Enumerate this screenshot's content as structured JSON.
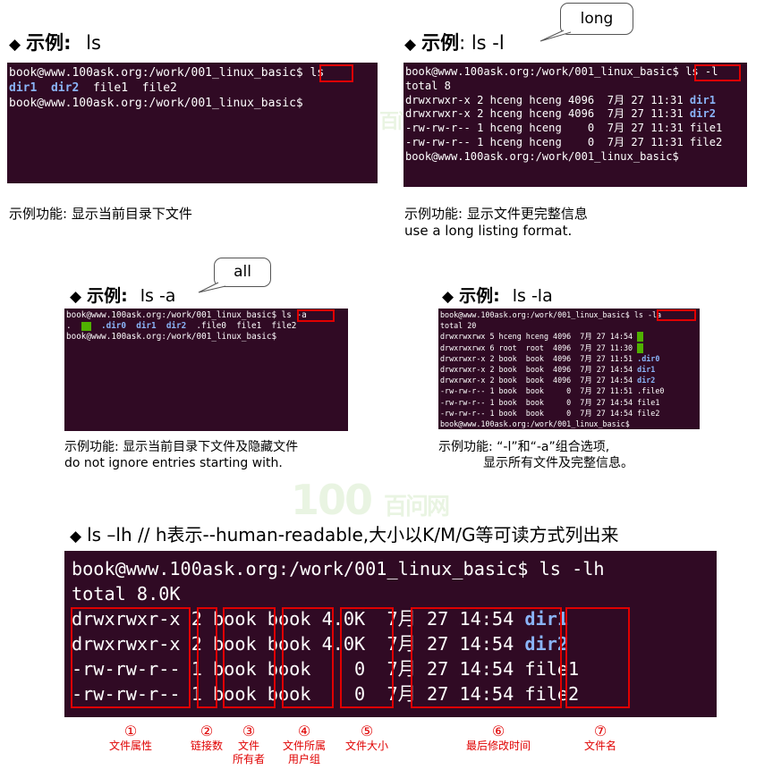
{
  "watermark": {
    "logo": "100",
    "brand": "百问网"
  },
  "ex1": {
    "diamond": "◆",
    "label": "示例:",
    "command": "ls",
    "lines": [
      "book@www.100ask.org:/work/001_linux_basic$ ls",
      "book@www.100ask.org:/work/001_linux_basic$"
    ],
    "ls_items": [
      "dir1",
      "dir2",
      "file1",
      "file2"
    ],
    "caption": "示例功能: 显示当前目录下文件"
  },
  "ex2": {
    "diamond": "◆",
    "label": "示例",
    "command": ": ls -l",
    "bubble": "long",
    "rows": [
      {
        "perm": "drwxrwxr-x",
        "links": "2",
        "owner": "hceng",
        "group": "hceng",
        "size": "4096",
        "month": "7月",
        "day": "27",
        "time": "11:31",
        "name": "dir1",
        "is_dir": true
      },
      {
        "perm": "drwxrwxr-x",
        "links": "2",
        "owner": "hceng",
        "group": "hceng",
        "size": "4096",
        "month": "7月",
        "day": "27",
        "time": "11:31",
        "name": "dir2",
        "is_dir": true
      },
      {
        "perm": "-rw-rw-r--",
        "links": "1",
        "owner": "hceng",
        "group": "hceng",
        "size": "0",
        "month": "7月",
        "day": "27",
        "time": "11:31",
        "name": "file1",
        "is_dir": false
      },
      {
        "perm": "-rw-rw-r--",
        "links": "1",
        "owner": "hceng",
        "group": "hceng",
        "size": "0",
        "month": "7月",
        "day": "27",
        "time": "11:31",
        "name": "file2",
        "is_dir": false
      }
    ],
    "prompt": "book@www.100ask.org:/work/001_linux_basic$ ls -l",
    "total": "total 8",
    "end_prompt": "book@www.100ask.org:/work/001_linux_basic$",
    "caption1": "示例功能: 显示文件更完整信息",
    "caption2": "use a long listing format."
  },
  "ex3": {
    "diamond": "◆",
    "label": "示例:",
    "command": "ls -a",
    "bubble": "all",
    "prompt": "book@www.100ask.org:/work/001_linux_basic$ ls -a",
    "listing": ".  [..]  .dir0  dir1  dir2  .file0  file1  file2",
    "end_prompt": "book@www.100ask.org:/work/001_linux_basic$",
    "caption1": "示例功能: 显示当前目录下文件及隐藏文件",
    "caption2": "do not ignore entries starting with."
  },
  "ex4": {
    "diamond": "◆",
    "label": "示例:",
    "command": "ls -la",
    "prompt": "book@www.100ask.org:/work/001_linux_basic$ ls -la",
    "total": "total 20",
    "rows": [
      {
        "line": "drwxrwxrwx 5 hceng hceng 4096  7月 27 14:54 ",
        "name": "",
        "is_dir": false,
        "green": true
      },
      {
        "line": "drwxrwxrwx 6 root  root  4096  7月 27 11:30 ",
        "name": "",
        "is_dir": false,
        "green": true
      },
      {
        "line": "drwxrwxr-x 2 book  book  4096  7月 27 11:51 ",
        "name": ".dir0",
        "is_dir": true,
        "green": false
      },
      {
        "line": "drwxrwxr-x 2 book  book  4096  7月 27 14:54 ",
        "name": "dir1",
        "is_dir": true,
        "green": false
      },
      {
        "line": "drwxrwxr-x 2 book  book  4096  7月 27 14:54 ",
        "name": "dir2",
        "is_dir": true,
        "green": false
      },
      {
        "line": "-rw-rw-r-- 1 book  book     0  7月 27 11:51 ",
        "name": ".file0",
        "is_dir": false,
        "green": false
      },
      {
        "line": "-rw-rw-r-- 1 book  book     0  7月 27 14:54 ",
        "name": "file1",
        "is_dir": false,
        "green": false
      },
      {
        "line": "-rw-rw-r-- 1 book  book     0  7月 27 14:54 ",
        "name": "file2",
        "is_dir": false,
        "green": false
      }
    ],
    "end_prompt": "book@www.100ask.org:/work/001_linux_basic$",
    "caption1": "示例功能: “-l”和“-a”组合选项,",
    "caption2": "显示所有文件及完整信息。"
  },
  "ex5": {
    "diamond": "◆",
    "heading": "ls –lh  // h表示--human-readable,大小以K/M/G等可读方式列出来",
    "prompt": "book@www.100ask.org:/work/001_linux_basic$ ls -lh",
    "total": "total 8.0K",
    "rows": [
      {
        "perm": "drwxrwxr-x",
        "links": "2",
        "owner": "book",
        "group": "book",
        "size": "4.0K",
        "month": "7月",
        "day": "27",
        "time": "14:54",
        "name": "dir1",
        "is_dir": true
      },
      {
        "perm": "drwxrwxr-x",
        "links": "2",
        "owner": "book",
        "group": "book",
        "size": "4.0K",
        "month": "7月",
        "day": "27",
        "time": "14:54",
        "name": "dir2",
        "is_dir": true
      },
      {
        "perm": "-rw-rw-r--",
        "links": "1",
        "owner": "book",
        "group": "book",
        "size": "0",
        "month": "7月",
        "day": "27",
        "time": "14:54",
        "name": "file1",
        "is_dir": false
      },
      {
        "perm": "-rw-rw-r--",
        "links": "1",
        "owner": "book",
        "group": "book",
        "size": "0",
        "month": "7月",
        "day": "27",
        "time": "14:54",
        "name": "file2",
        "is_dir": false
      }
    ],
    "legend": [
      {
        "num": "①",
        "lines": [
          "文件属性"
        ]
      },
      {
        "num": "②",
        "lines": [
          "链接数"
        ]
      },
      {
        "num": "③",
        "lines": [
          "文件",
          "所有者"
        ]
      },
      {
        "num": "④",
        "lines": [
          "文件所属",
          "用户组"
        ]
      },
      {
        "num": "⑤",
        "lines": [
          "文件大小"
        ]
      },
      {
        "num": "⑥",
        "lines": [
          "最后修改时间"
        ]
      },
      {
        "num": "⑦",
        "lines": [
          "文件名"
        ]
      }
    ]
  },
  "colors": {
    "terminal_bg": "#300a24",
    "dir_color": "#8ab4f8",
    "highlight": "#e00000",
    "green_block": "#4fb000"
  }
}
